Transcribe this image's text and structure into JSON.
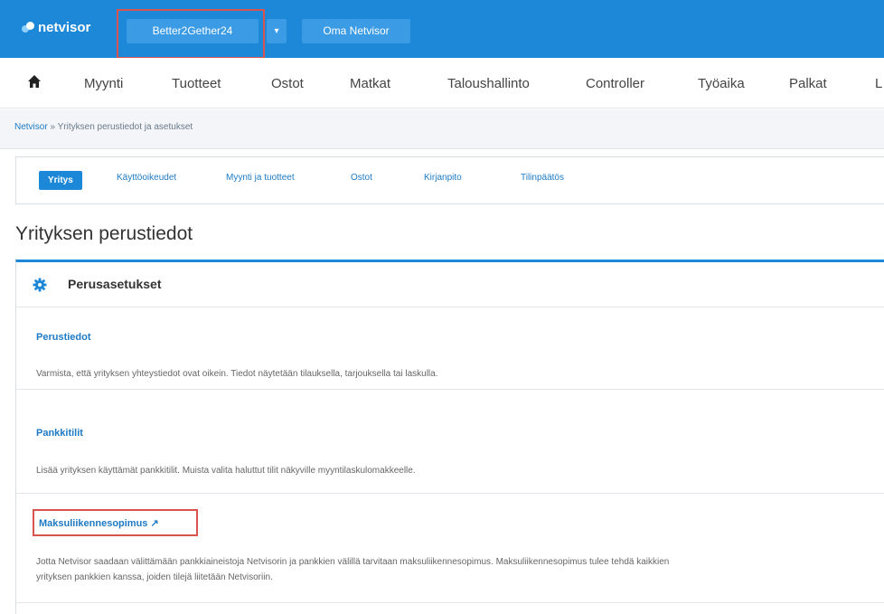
{
  "topbar": {
    "logo": "netvisor",
    "company": "Better2Gether24",
    "dropdown": "▾",
    "oma": "Oma Netvisor"
  },
  "mainnav": {
    "items": [
      "Myynti",
      "Tuotteet",
      "Ostot",
      "Matkat",
      "Taloushallinto",
      "Controller",
      "Työaika",
      "Palkat",
      "L"
    ]
  },
  "breadcrumb": {
    "root": "Netvisor",
    "separator": "»",
    "current": "Yrityksen perustiedot ja asetukset"
  },
  "tabs": [
    "Yritys",
    "Käyttöoikeudet",
    "Myynti ja tuotteet",
    "Ostot",
    "Kirjanpito",
    "Tilinpäätös"
  ],
  "page_title": "Yrityksen perustiedot",
  "section": {
    "title": "Perusasetukset",
    "rows": [
      {
        "title": "Perustiedot",
        "desc": "Varmista, että yrityksen yhteystiedot ovat oikein. Tiedot näytetään tilauksella, tarjouksella tai laskulla."
      },
      {
        "title": "Pankkitilit",
        "desc": "Lisää yrityksen käyttämät pankkitilit. Muista valita haluttut tilit näkyville myyntilaskulomakkeelle."
      },
      {
        "title": "Maksuliikennesopimus ↗",
        "desc1": "Jotta Netvisor saadaan välittämään pankkiaineistoja Netvisorin ja pankkien välillä tarvitaan maksuliikennesopimus. Maksuliikennesopimus tulee tehdä kaikkien",
        "desc2": "yrityksen pankkien kanssa, joiden tilejä liitetään Netvisoriin."
      }
    ]
  },
  "colors": {
    "brand": "#1e88d8",
    "highlight": "#d9534f",
    "link": "#1e7ac4"
  }
}
